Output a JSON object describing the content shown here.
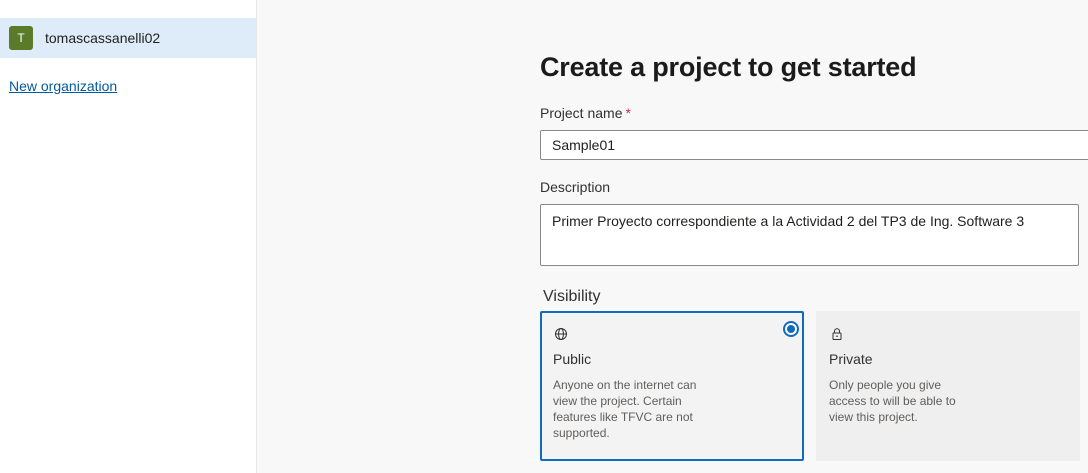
{
  "sidebar": {
    "organization": {
      "avatar_letter": "T",
      "name": "tomascassanelli02"
    },
    "new_organization_link": "New organization"
  },
  "form": {
    "title": "Create a project to get started",
    "project_name": {
      "label": "Project name",
      "required_marker": "*",
      "value": "Sample01"
    },
    "description": {
      "label": "Description",
      "value": "Primer Proyecto correspondiente a la Actividad 2 del TP3 de Ing. Software 3"
    },
    "visibility": {
      "label": "Visibility",
      "options": [
        {
          "icon": "globe-icon",
          "title": "Public",
          "description": "Anyone on the internet can view the project. Certain features like TFVC are not supported.",
          "selected": true
        },
        {
          "icon": "lock-icon",
          "title": "Private",
          "description": "Only people you give access to will be able to view this project.",
          "selected": false
        }
      ]
    }
  },
  "colors": {
    "accent": "#0f6cbd",
    "sidebar_selected": "#deecf9",
    "avatar": "#5b7a2a",
    "link": "#005a9e",
    "required": "#c4314b"
  }
}
